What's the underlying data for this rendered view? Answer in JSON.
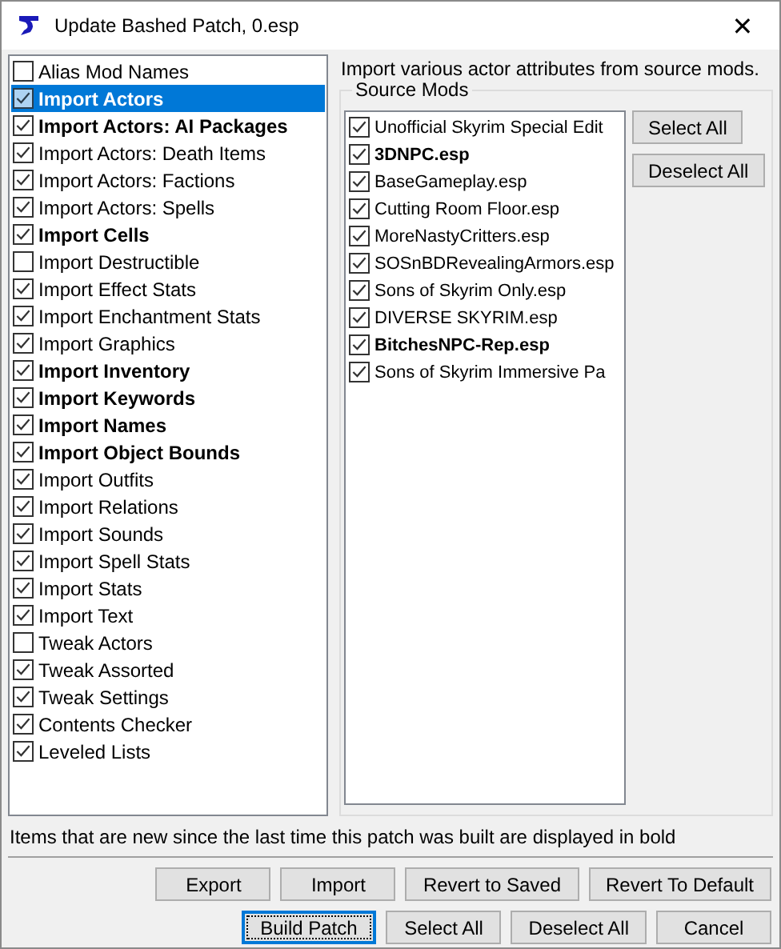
{
  "window": {
    "title": "Update Bashed Patch, 0.esp",
    "close": "✕"
  },
  "patchers": [
    {
      "label": "Alias Mod Names",
      "checked": false,
      "bold": false,
      "selected": false
    },
    {
      "label": "Import Actors",
      "checked": true,
      "bold": true,
      "selected": true
    },
    {
      "label": "Import Actors: AI Packages",
      "checked": true,
      "bold": true,
      "selected": false
    },
    {
      "label": "Import Actors: Death Items",
      "checked": true,
      "bold": false,
      "selected": false
    },
    {
      "label": "Import Actors: Factions",
      "checked": true,
      "bold": false,
      "selected": false
    },
    {
      "label": "Import Actors: Spells",
      "checked": true,
      "bold": false,
      "selected": false
    },
    {
      "label": "Import Cells",
      "checked": true,
      "bold": true,
      "selected": false
    },
    {
      "label": "Import Destructible",
      "checked": false,
      "bold": false,
      "selected": false
    },
    {
      "label": "Import Effect Stats",
      "checked": true,
      "bold": false,
      "selected": false
    },
    {
      "label": "Import Enchantment Stats",
      "checked": true,
      "bold": false,
      "selected": false
    },
    {
      "label": "Import Graphics",
      "checked": true,
      "bold": false,
      "selected": false
    },
    {
      "label": "Import Inventory",
      "checked": true,
      "bold": true,
      "selected": false
    },
    {
      "label": "Import Keywords",
      "checked": true,
      "bold": true,
      "selected": false
    },
    {
      "label": "Import Names",
      "checked": true,
      "bold": true,
      "selected": false
    },
    {
      "label": "Import Object Bounds",
      "checked": true,
      "bold": true,
      "selected": false
    },
    {
      "label": "Import Outfits",
      "checked": true,
      "bold": false,
      "selected": false
    },
    {
      "label": "Import Relations",
      "checked": true,
      "bold": false,
      "selected": false
    },
    {
      "label": "Import Sounds",
      "checked": true,
      "bold": false,
      "selected": false
    },
    {
      "label": "Import Spell Stats",
      "checked": true,
      "bold": false,
      "selected": false
    },
    {
      "label": "Import Stats",
      "checked": true,
      "bold": false,
      "selected": false
    },
    {
      "label": "Import Text",
      "checked": true,
      "bold": false,
      "selected": false
    },
    {
      "label": "Tweak Actors",
      "checked": false,
      "bold": false,
      "selected": false
    },
    {
      "label": "Tweak Assorted",
      "checked": true,
      "bold": false,
      "selected": false
    },
    {
      "label": "Tweak Settings",
      "checked": true,
      "bold": false,
      "selected": false
    },
    {
      "label": "Contents Checker",
      "checked": true,
      "bold": false,
      "selected": false
    },
    {
      "label": "Leveled Lists",
      "checked": true,
      "bold": false,
      "selected": false
    }
  ],
  "description": "Import various actor attributes from source mods.",
  "source_mods": {
    "title": "Source Mods",
    "items": [
      {
        "label": "Unofficial Skyrim Special Edit",
        "checked": true,
        "bold": false
      },
      {
        "label": "3DNPC.esp",
        "checked": true,
        "bold": true
      },
      {
        "label": "BaseGameplay.esp",
        "checked": true,
        "bold": false
      },
      {
        "label": "Cutting Room Floor.esp",
        "checked": true,
        "bold": false
      },
      {
        "label": "MoreNastyCritters.esp",
        "checked": true,
        "bold": false
      },
      {
        "label": "SOSnBDRevealingArmors.esp",
        "checked": true,
        "bold": false
      },
      {
        "label": "Sons of Skyrim Only.esp",
        "checked": true,
        "bold": false
      },
      {
        "label": "DIVERSE SKYRIM.esp",
        "checked": true,
        "bold": false
      },
      {
        "label": "BitchesNPC-Rep.esp",
        "checked": true,
        "bold": true
      },
      {
        "label": "Sons of Skyrim Immersive Pa",
        "checked": true,
        "bold": false
      }
    ],
    "buttons": [
      "Select All",
      "Deselect All"
    ]
  },
  "note": "Items that are new since the last time this patch was built are displayed in bold",
  "button_rows": [
    [
      {
        "label": "Export",
        "focused": false
      },
      {
        "label": "Import",
        "focused": false
      },
      {
        "label": "Revert to Saved",
        "focused": false
      },
      {
        "label": "Revert To Default",
        "focused": false
      }
    ],
    [
      {
        "label": "Build Patch",
        "focused": true
      },
      {
        "label": "Select All",
        "focused": false
      },
      {
        "label": "Deselect All",
        "focused": false
      },
      {
        "label": "Cancel",
        "focused": false
      }
    ]
  ]
}
